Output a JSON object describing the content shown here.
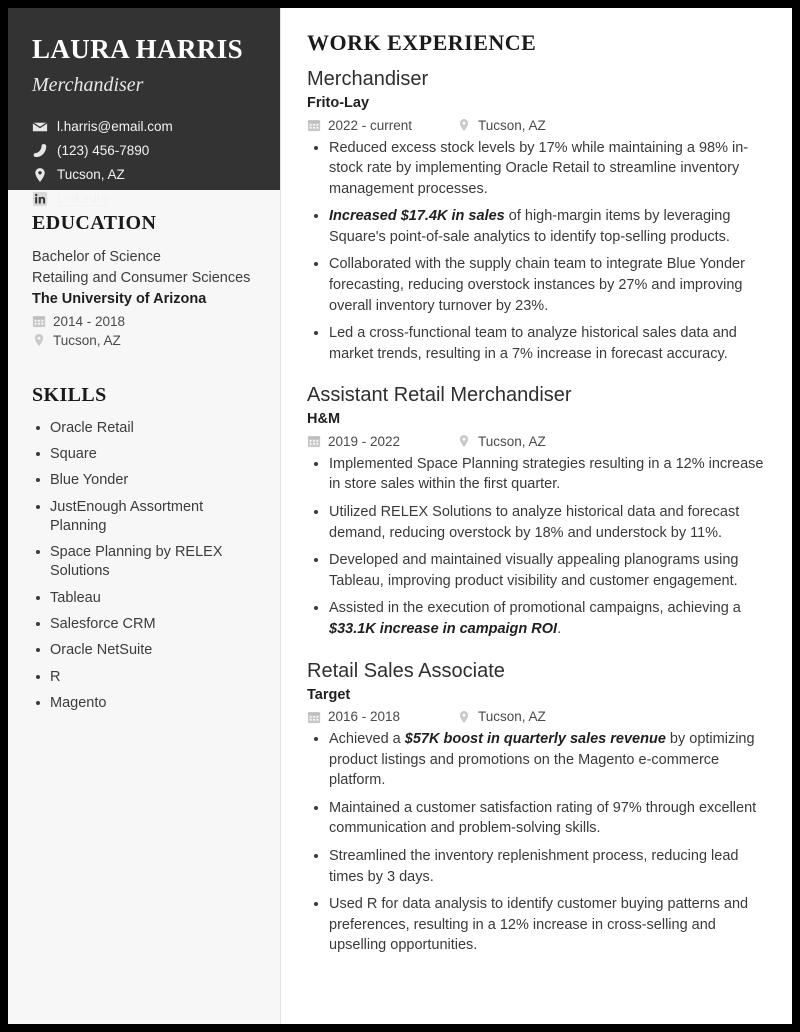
{
  "theme": {
    "sidebar_header_bg": "#333333",
    "sidebar_body_bg": "#f7f7f7",
    "page_bg": "#ffffff",
    "outer_border": "#000000",
    "text_dark": "#1f1f1f",
    "text_body": "#3a3a3a",
    "icon_muted": "#c9c9c9"
  },
  "sidebar": {
    "name": "LAURA HARRIS",
    "subtitle": "Merchandiser",
    "contacts": [
      {
        "icon": "envelope-icon",
        "name": "contact-email",
        "text": "l.harris@email.com",
        "link": false
      },
      {
        "icon": "phone-icon",
        "name": "contact-phone",
        "text": "(123) 456-7890",
        "link": false
      },
      {
        "icon": "location-pin-icon",
        "name": "contact-location",
        "text": "Tucson, AZ",
        "link": false
      },
      {
        "icon": "linkedin-icon",
        "name": "contact-linkedin",
        "text": "LinkedIn",
        "link": true
      }
    ],
    "education": {
      "heading": "EDUCATION",
      "degree": "Bachelor of Science",
      "field": "Retailing and Consumer Sciences",
      "school": "The University of Arizona",
      "dates": "2014 - 2018",
      "location": "Tucson, AZ"
    },
    "skills": {
      "heading": "SKILLS",
      "items": [
        "Oracle Retail",
        "Square",
        "Blue Yonder",
        "JustEnough Assortment Planning",
        "Space Planning by RELEX Solutions",
        "Tableau",
        "Salesforce CRM",
        "Oracle NetSuite",
        "R",
        "Magento"
      ]
    }
  },
  "main": {
    "heading": "WORK EXPERIENCE",
    "jobs": [
      {
        "title": "Merchandiser",
        "company": "Frito-Lay",
        "dates": "2022 - current",
        "location": "Tucson, AZ",
        "bullets": [
          {
            "pre": "",
            "em": "",
            "post": "Reduced excess stock levels by 17% while maintaining a 98% in-stock rate by implementing Oracle Retail to streamline inventory management processes."
          },
          {
            "pre": "",
            "em": "Increased $17.4K in sales",
            "post": " of high-margin items by leveraging Square's point-of-sale analytics to identify top-selling products."
          },
          {
            "pre": "",
            "em": "",
            "post": "Collaborated with the supply chain team to integrate Blue Yonder forecasting, reducing overstock instances by 27% and improving overall inventory turnover by 23%."
          },
          {
            "pre": "",
            "em": "",
            "post": "Led a cross-functional team to analyze historical sales data and market trends, resulting in a 7% increase in forecast accuracy."
          }
        ]
      },
      {
        "title": "Assistant Retail Merchandiser",
        "company": "H&M",
        "dates": "2019 - 2022",
        "location": "Tucson, AZ",
        "bullets": [
          {
            "pre": "",
            "em": "",
            "post": "Implemented Space Planning strategies resulting in a 12% increase in store sales within the first quarter."
          },
          {
            "pre": "",
            "em": "",
            "post": "Utilized RELEX Solutions to analyze historical data and forecast demand, reducing overstock by 18% and understock by 11%."
          },
          {
            "pre": "",
            "em": "",
            "post": "Developed and maintained visually appealing planograms using Tableau, improving product visibility and customer engagement."
          },
          {
            "pre": "Assisted in the execution of promotional campaigns, achieving a ",
            "em": "$33.1K increase in campaign ROI",
            "post": "."
          }
        ]
      },
      {
        "title": "Retail Sales Associate",
        "company": "Target",
        "dates": "2016 - 2018",
        "location": "Tucson, AZ",
        "bullets": [
          {
            "pre": "Achieved a ",
            "em": "$57K boost in quarterly sales revenue",
            "post": " by optimizing product listings and promotions on the Magento e-commerce platform."
          },
          {
            "pre": "",
            "em": "",
            "post": "Maintained a customer satisfaction rating of 97% through excellent communication and problem-solving skills."
          },
          {
            "pre": "",
            "em": "",
            "post": "Streamlined the inventory replenishment process, reducing lead times by 3 days."
          },
          {
            "pre": "",
            "em": "",
            "post": "Used R for data analysis to identify customer buying patterns and preferences, resulting in a 12% increase in cross-selling and upselling opportunities."
          }
        ]
      }
    ]
  }
}
